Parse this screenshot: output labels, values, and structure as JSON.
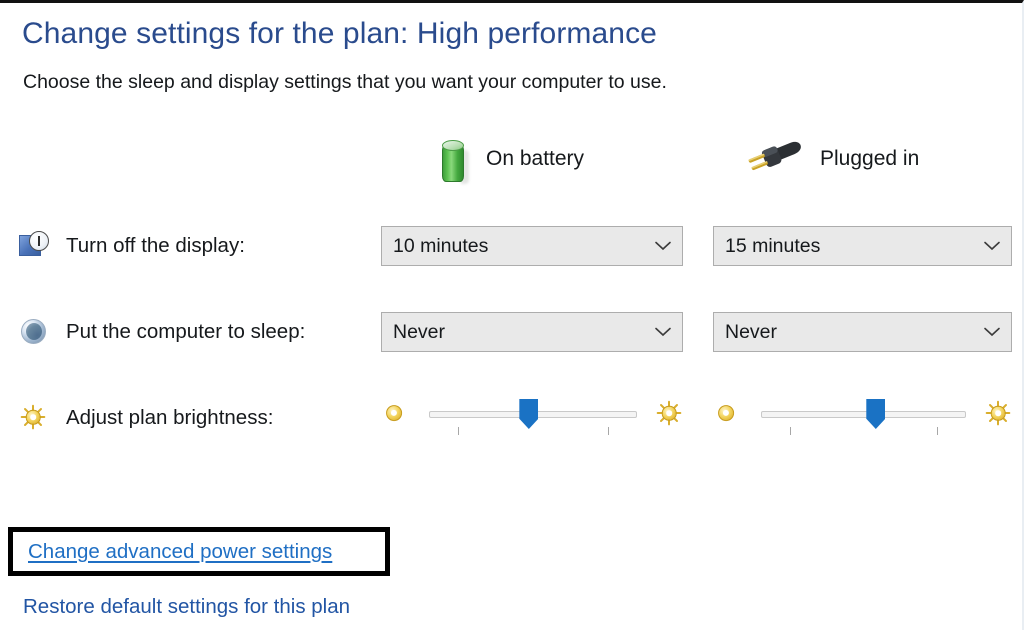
{
  "header": {
    "title": "Change settings for the plan: High performance",
    "subtitle": "Choose the sleep and display settings that you want your computer to use."
  },
  "columns": [
    {
      "id": "battery",
      "label": "On battery",
      "icon": "battery-icon"
    },
    {
      "id": "plugged",
      "label": "Plugged in",
      "icon": "power-plug-icon"
    }
  ],
  "rows": [
    {
      "id": "turn-off-display",
      "label": "Turn off the display:",
      "icon": "display-clock-icon",
      "type": "dropdown",
      "battery_value": "10 minutes",
      "plugged_value": "15 minutes"
    },
    {
      "id": "put-computer-to-sleep",
      "label": "Put the computer to sleep:",
      "icon": "sleep-moon-icon",
      "type": "dropdown",
      "battery_value": "Never",
      "plugged_value": "Never"
    },
    {
      "id": "adjust-plan-brightness",
      "label": "Adjust plan brightness:",
      "icon": "brightness-sun-icon",
      "type": "slider",
      "battery_percent": 48,
      "plugged_percent": 56,
      "low_icon": "dim-sun-icon",
      "high_icon": "bright-sun-icon"
    }
  ],
  "links": {
    "advanced": "Change advanced power settings",
    "restore": "Restore default settings for this plan"
  },
  "colors": {
    "title_blue": "#2a4b8d",
    "link_blue": "#1f6fc4",
    "slider_thumb_blue": "#1a72c4",
    "battery_green": "#5cc251",
    "sun_gold": "#d8a81f",
    "highlight_box": "#000000"
  }
}
